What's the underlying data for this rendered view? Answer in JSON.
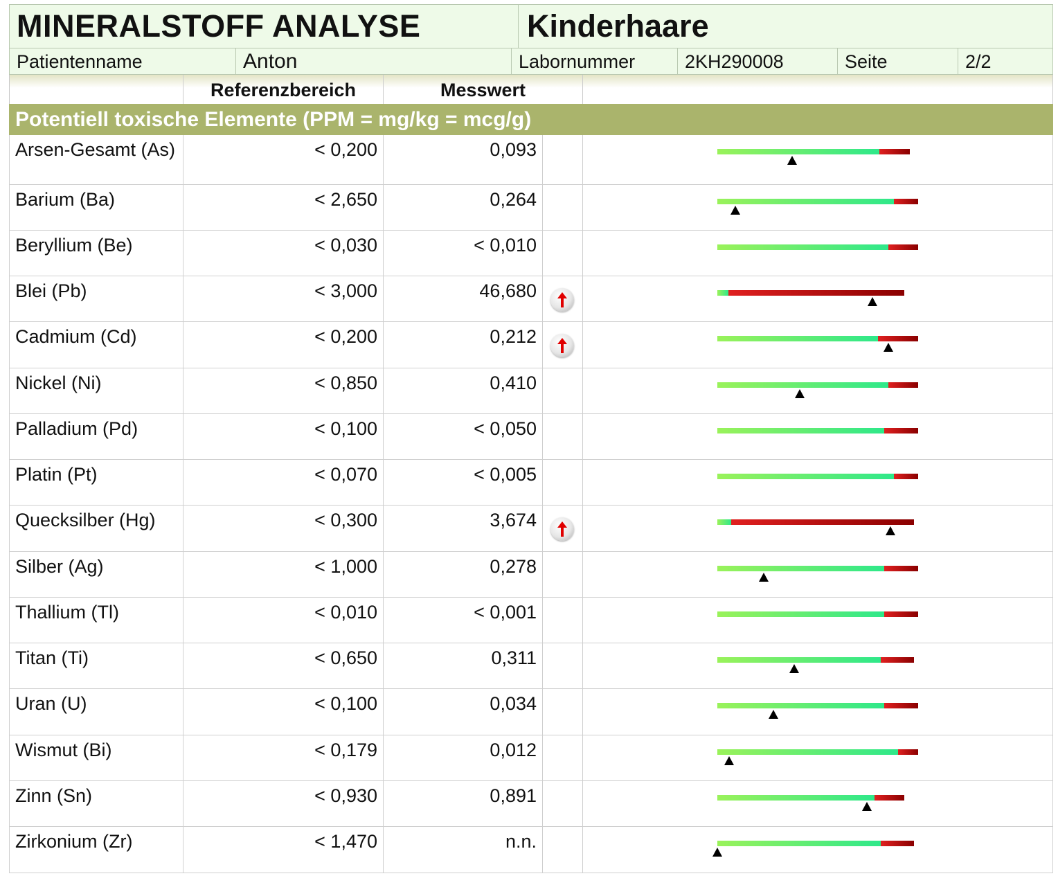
{
  "header": {
    "title": "MINERALSTOFF ANALYSE",
    "sample_type": "Kinderhaare",
    "patient_label": "Patientenname",
    "patient_value": "Anton",
    "lab_label": "Labornummer",
    "lab_value": "2KH290008",
    "page_label": "Seite",
    "page_value": "2/2"
  },
  "columns": {
    "reference": "Referenzbereich",
    "measured": "Messwert"
  },
  "section_title": "Potentiell toxische Elemente (PPM = mg/kg = mcg/g)",
  "colors": {
    "section_bg": "#aab46c",
    "header_bg": "#eefae8",
    "flag_arrow": "#e00000",
    "bar_green_start": "#9af25a",
    "bar_green_end": "#2ee88a",
    "bar_red_start": "#e02020",
    "bar_red_end": "#8a0000"
  },
  "rows": [
    {
      "name": "Arsen-Gesamt (As)",
      "reference": "< 0,200",
      "value": "0,093",
      "flag": false,
      "bar_length": 0.96,
      "green_fraction": 0.84,
      "marker": 0.39
    },
    {
      "name": "Barium (Ba)",
      "reference": "< 2,650",
      "value": "0,264",
      "flag": false,
      "bar_length": 1.0,
      "green_fraction": 0.88,
      "marker": 0.09
    },
    {
      "name": "Beryllium (Be)",
      "reference": "< 0,030",
      "value": "< 0,010",
      "flag": false,
      "bar_length": 1.0,
      "green_fraction": 0.85,
      "marker": null
    },
    {
      "name": "Blei (Pb)",
      "reference": "< 3,000",
      "value": "46,680",
      "flag": true,
      "bar_length": 0.93,
      "green_fraction": 0.06,
      "marker": 0.83
    },
    {
      "name": "Cadmium (Cd)",
      "reference": "< 0,200",
      "value": "0,212",
      "flag": true,
      "bar_length": 1.0,
      "green_fraction": 0.8,
      "marker": 0.85
    },
    {
      "name": "Nickel (Ni)",
      "reference": "< 0,850",
      "value": "0,410",
      "flag": false,
      "bar_length": 1.0,
      "green_fraction": 0.85,
      "marker": 0.41
    },
    {
      "name": "Palladium (Pd)",
      "reference": "< 0,100",
      "value": "< 0,050",
      "flag": false,
      "bar_length": 1.0,
      "green_fraction": 0.83,
      "marker": null
    },
    {
      "name": "Platin (Pt)",
      "reference": "< 0,070",
      "value": "< 0,005",
      "flag": false,
      "bar_length": 1.0,
      "green_fraction": 0.88,
      "marker": null
    },
    {
      "name": "Quecksilber (Hg)",
      "reference": "< 0,300",
      "value": "3,674",
      "flag": true,
      "bar_length": 0.98,
      "green_fraction": 0.07,
      "marker": 0.88
    },
    {
      "name": "Silber (Ag)",
      "reference": "< 1,000",
      "value": "0,278",
      "flag": false,
      "bar_length": 1.0,
      "green_fraction": 0.83,
      "marker": 0.23
    },
    {
      "name": "Thallium (Tl)",
      "reference": "< 0,010",
      "value": "< 0,001",
      "flag": false,
      "bar_length": 1.0,
      "green_fraction": 0.83,
      "marker": null
    },
    {
      "name": "Titan (Ti)",
      "reference": "< 0,650",
      "value": "0,311",
      "flag": false,
      "bar_length": 0.98,
      "green_fraction": 0.83,
      "marker": 0.39
    },
    {
      "name": "Uran (U)",
      "reference": "< 0,100",
      "value": "0,034",
      "flag": false,
      "bar_length": 1.0,
      "green_fraction": 0.83,
      "marker": 0.28
    },
    {
      "name": "Wismut (Bi)",
      "reference": "< 0,179",
      "value": "0,012",
      "flag": false,
      "bar_length": 1.0,
      "green_fraction": 0.9,
      "marker": 0.06
    },
    {
      "name": "Zinn (Sn)",
      "reference": "< 0,930",
      "value": "0,891",
      "flag": false,
      "bar_length": 0.93,
      "green_fraction": 0.84,
      "marker": 0.8
    },
    {
      "name": "Zirkonium (Zr)",
      "reference": "< 1,470",
      "value": "n.n.",
      "flag": false,
      "bar_length": 0.98,
      "green_fraction": 0.83,
      "marker": 0.0
    }
  ]
}
